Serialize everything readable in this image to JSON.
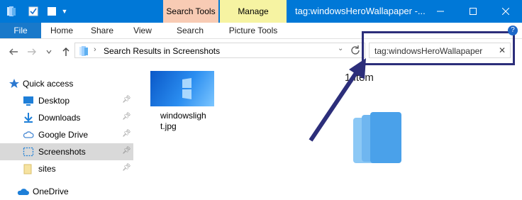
{
  "window": {
    "contextual_tabs": {
      "search_tools": "Search Tools",
      "manage": "Manage"
    },
    "title": "tag:windowsHeroWallapaper -..."
  },
  "ribbon": {
    "tabs": [
      "File",
      "Home",
      "Share",
      "View",
      "Search",
      "Picture Tools"
    ]
  },
  "address": {
    "path": "Search Results in Screenshots",
    "search_value": "tag:windowsHeroWallapaper"
  },
  "nav": {
    "items": [
      {
        "label": "Quick access",
        "icon": "star-icon"
      },
      {
        "label": "Desktop",
        "icon": "desktop-icon",
        "pinned": true
      },
      {
        "label": "Downloads",
        "icon": "download-icon",
        "pinned": true
      },
      {
        "label": "Google Drive",
        "icon": "cloud-icon",
        "pinned": true
      },
      {
        "label": "Screenshots",
        "icon": "screenshot-folder-icon",
        "pinned": true,
        "selected": true
      },
      {
        "label": "sites",
        "icon": "folder-icon",
        "pinned": true
      },
      {
        "label": "OneDrive",
        "icon": "onedrive-icon"
      }
    ]
  },
  "content": {
    "file_name": "windowslight.jpg",
    "item_count": "1 item"
  },
  "colors": {
    "accent": "#0078d7",
    "search_tools_tab": "#f8cbb4",
    "manage_tab": "#f6f3a2",
    "annotation": "#2c2e7a"
  }
}
